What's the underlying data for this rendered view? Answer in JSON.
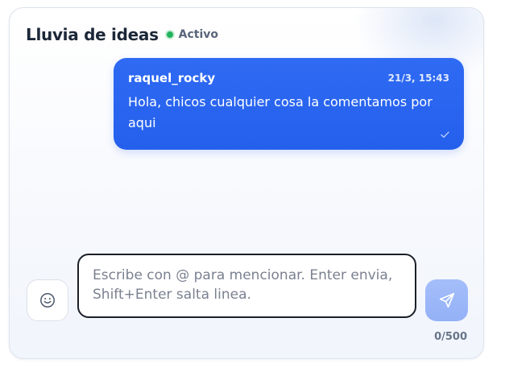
{
  "channel": {
    "title": "Lluvia de ideas",
    "status_label": "Activo",
    "status_color": "#22b35f"
  },
  "messages": [
    {
      "author": "raquel_rocky",
      "time": "21/3, 15:43",
      "text": "Hola, chicos cualquier cosa la comentamos por aqui",
      "status_icon": "check-icon"
    }
  ],
  "composer": {
    "value": "",
    "placeholder": "Escribe con @ para mencionar. Enter envia, Shift+Enter salta linea.",
    "char_count": "0/500",
    "emoji_icon": "smiley-icon",
    "send_icon": "paper-plane-icon"
  },
  "colors": {
    "accent": "#2563eb",
    "send_button_disabled": "#9db7f8",
    "composer_border": "#1a1f29"
  }
}
